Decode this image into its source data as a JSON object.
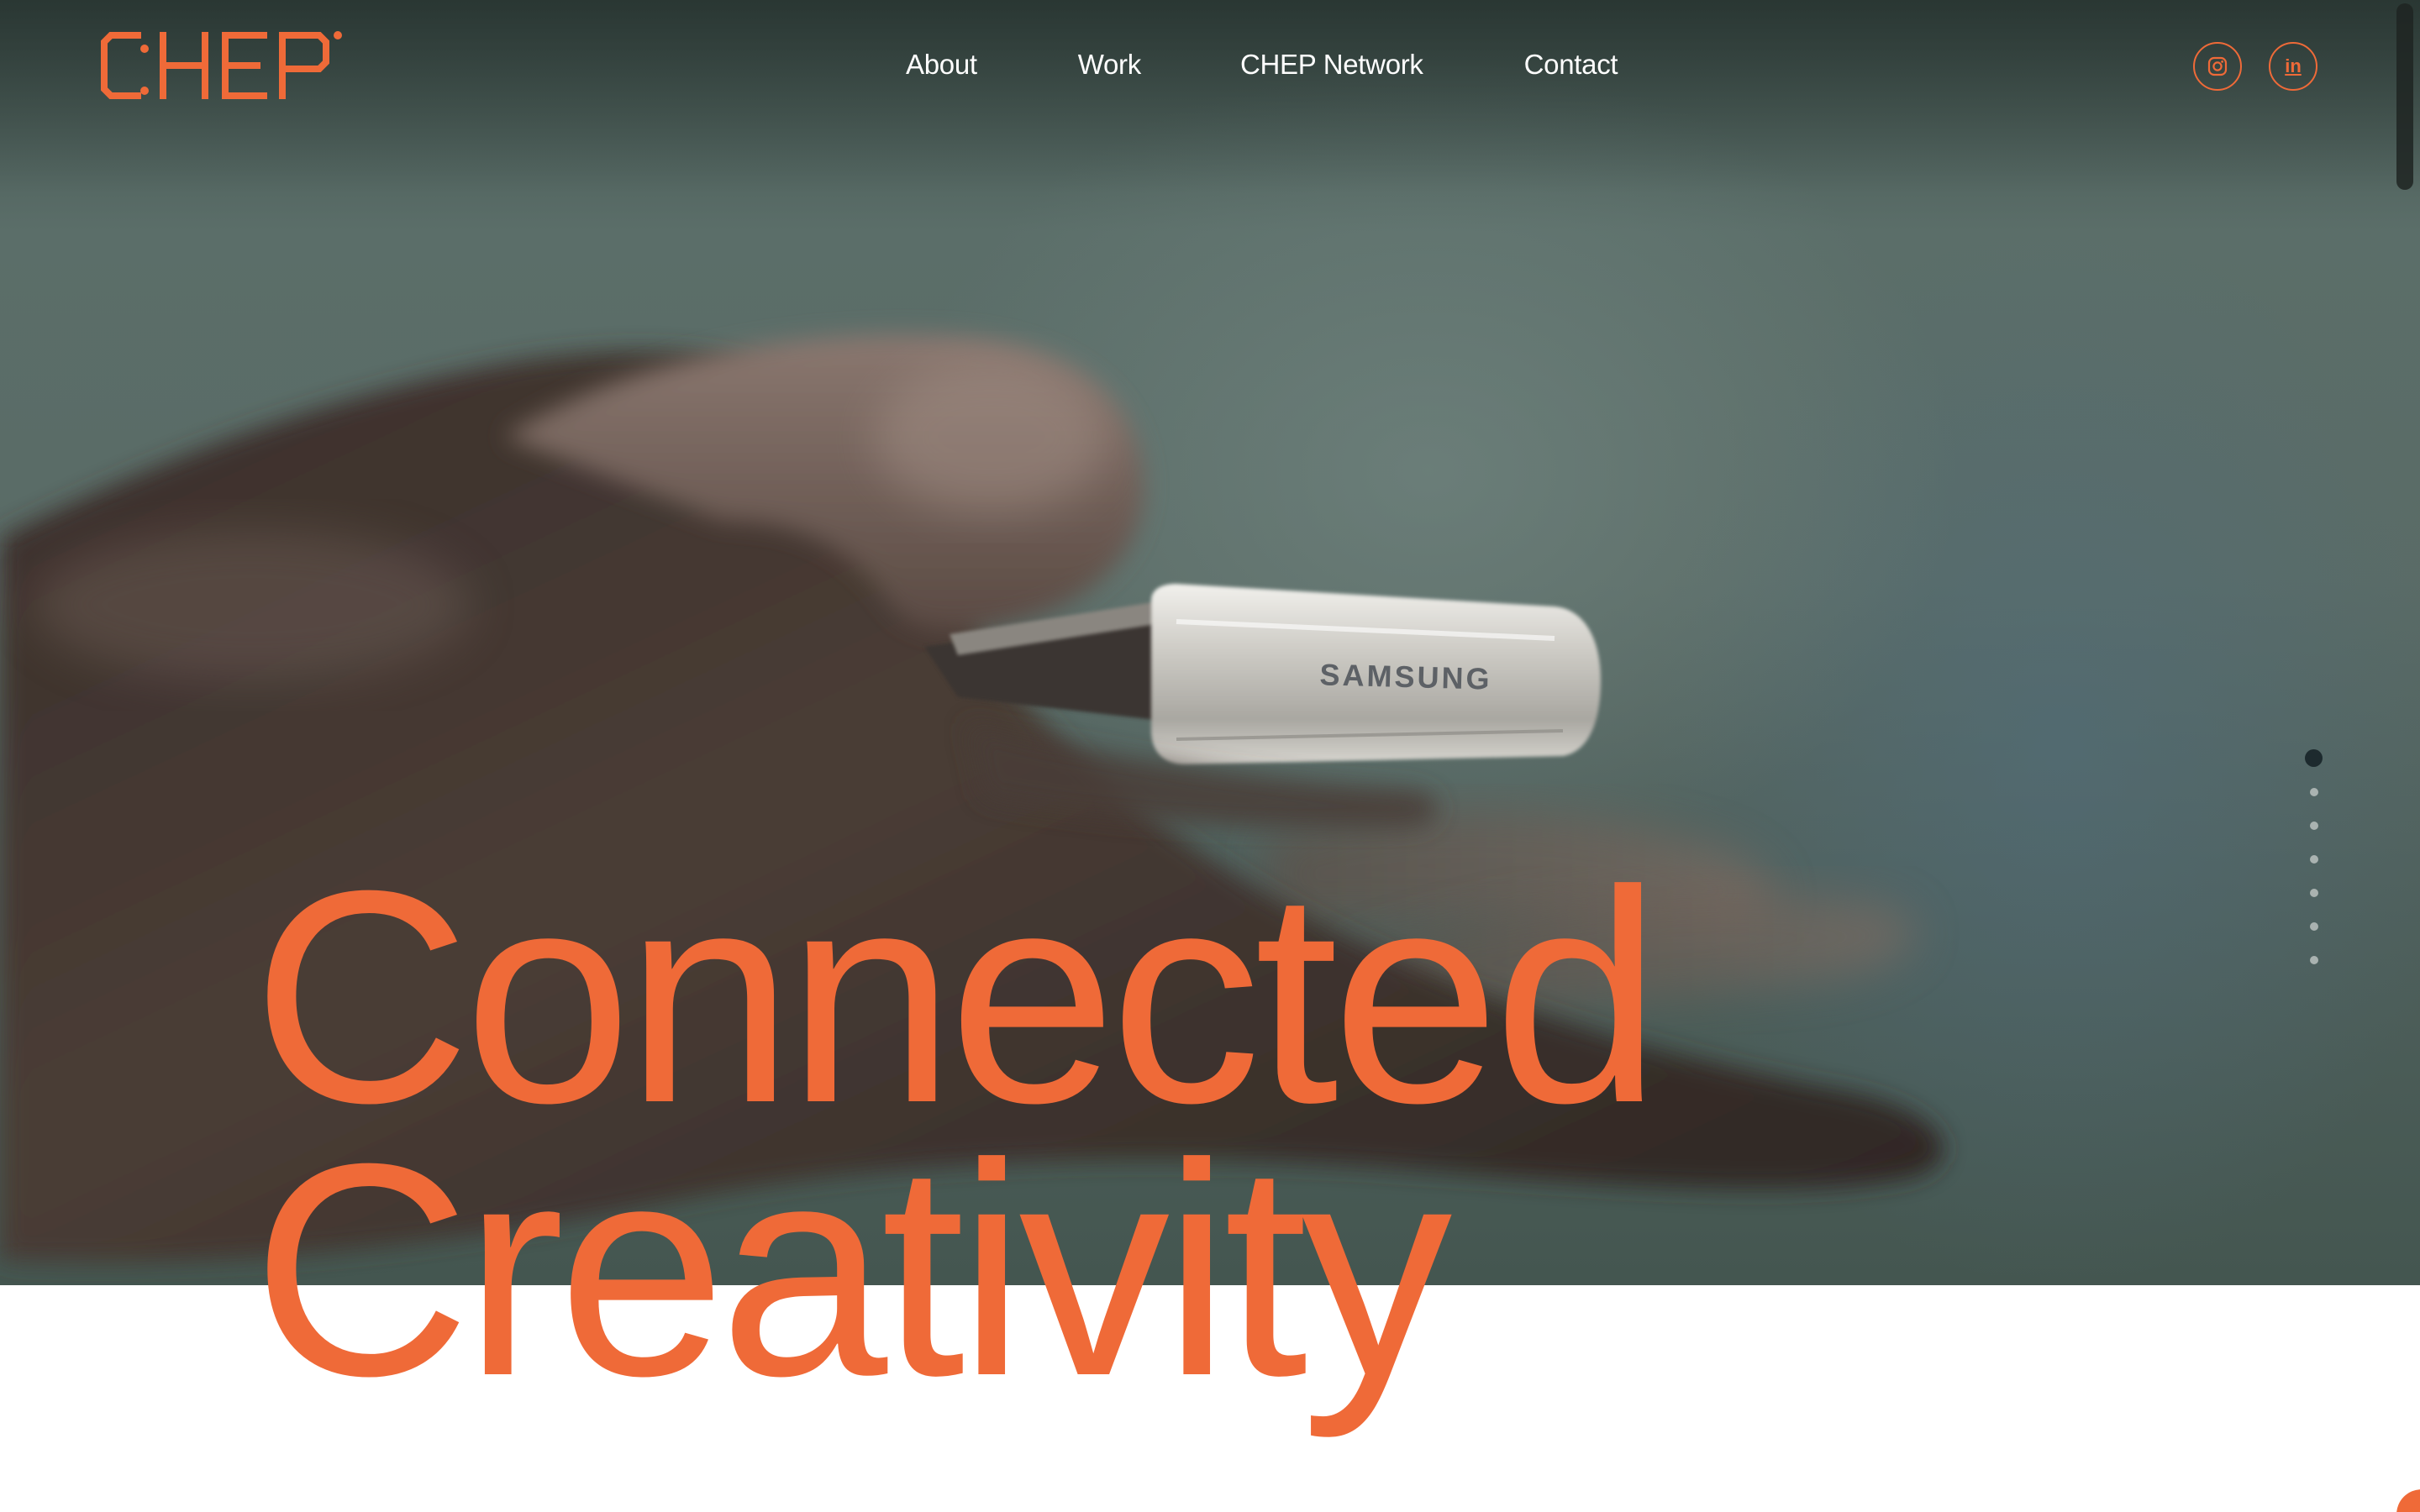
{
  "brand": {
    "logo_text": "CHEP",
    "accent_color": "#ef6a38"
  },
  "nav": {
    "items": [
      {
        "label": "About"
      },
      {
        "label": "Work"
      },
      {
        "label": "CHEP Network"
      },
      {
        "label": "Contact"
      }
    ]
  },
  "social": {
    "instagram_icon": "instagram-icon",
    "linkedin_label": "in"
  },
  "hero": {
    "headline_line1": "Connected",
    "headline_line2": "Creativity",
    "product_brand": "SAMSUNG",
    "slides_total": 7,
    "slide_active_index": 1
  },
  "colors": {
    "hero_dark": "#3e4f4a",
    "dot_active": "#1d2a2e",
    "nav_text": "#ffffff"
  }
}
